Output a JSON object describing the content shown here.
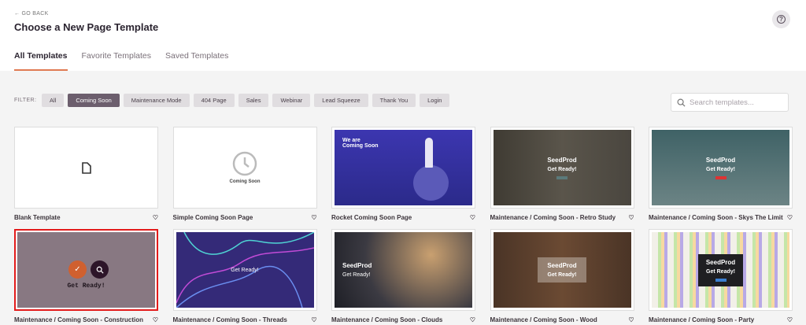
{
  "header": {
    "go_back": "← GO BACK",
    "title": "Choose a New Page Template",
    "help_icon": "question-circle-icon"
  },
  "tabs": [
    {
      "label": "All Templates",
      "active": true
    },
    {
      "label": "Favorite Templates"
    },
    {
      "label": "Saved Templates"
    }
  ],
  "filter": {
    "label": "FILTER:",
    "options": [
      "All",
      "Coming Soon",
      "Maintenance Mode",
      "404 Page",
      "Sales",
      "Webinar",
      "Lead Squeeze",
      "Thank You",
      "Login"
    ],
    "selected": "Coming Soon"
  },
  "search": {
    "placeholder": "Search templates..."
  },
  "accent": "#e07a52",
  "templates": [
    {
      "name": "Blank Template"
    },
    {
      "name": "Simple Coming Soon Page",
      "thumb_text": "Coming Soon"
    },
    {
      "name": "Rocket Coming Soon Page",
      "thumb_text": "We are Coming Soon"
    },
    {
      "name": "Maintenance / Coming Soon - Retro Study",
      "thumb_logo": "SeedProd",
      "thumb_text": "Get Ready!"
    },
    {
      "name": "Maintenance / Coming Soon - Skys The Limit",
      "thumb_logo": "SeedProd",
      "thumb_text": "Get Ready!"
    },
    {
      "name": "Maintenance / Coming Soon - Construction",
      "thumb_text": "Get Ready!",
      "selected": true
    },
    {
      "name": "Maintenance / Coming Soon - Threads",
      "thumb_text": "Get Ready!"
    },
    {
      "name": "Maintenance / Coming Soon - Clouds",
      "thumb_logo": "SeedProd",
      "thumb_text": "Get Ready!"
    },
    {
      "name": "Maintenance / Coming Soon - Wood",
      "thumb_logo": "SeedProd",
      "thumb_text": "Get Ready!"
    },
    {
      "name": "Maintenance / Coming Soon - Party",
      "thumb_logo": "SeedProd",
      "thumb_text": "Get Ready!"
    }
  ]
}
